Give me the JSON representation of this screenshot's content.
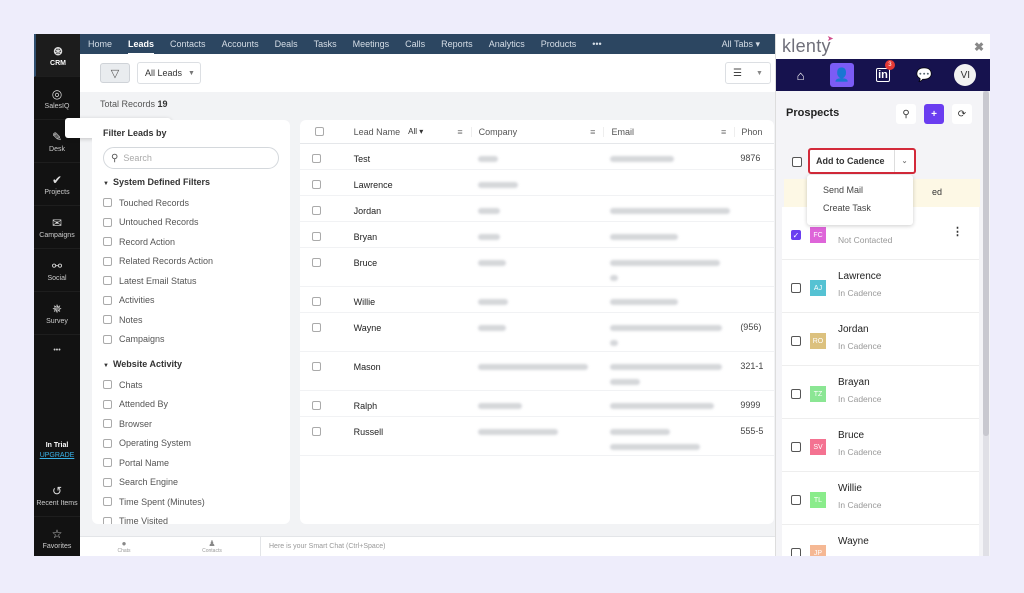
{
  "crm": {
    "leftnav": {
      "items": [
        {
          "label": "CRM",
          "icon": "crm-icon",
          "glyph": "⊛",
          "active": true
        },
        {
          "label": "SalesIQ",
          "icon": "salesiq-icon",
          "glyph": "◎"
        },
        {
          "label": "Desk",
          "icon": "desk-icon",
          "glyph": "✎"
        },
        {
          "label": "Projects",
          "icon": "check-icon",
          "glyph": "✔"
        },
        {
          "label": "Campaigns",
          "icon": "campaigns-icon",
          "glyph": "✉"
        },
        {
          "label": "Social",
          "icon": "social-icon",
          "glyph": "⚯"
        },
        {
          "label": "Survey",
          "icon": "survey-icon",
          "glyph": "✵"
        }
      ],
      "more": "•••",
      "trial_label": "In Trial",
      "upgrade_label": "UPGRADE",
      "recent_label": "Recent Items",
      "recent_glyph": "↺",
      "favorites_label": "Favorites",
      "favorites_glyph": "☆"
    },
    "tabs": [
      "Home",
      "Leads",
      "Contacts",
      "Accounts",
      "Deals",
      "Tasks",
      "Meetings",
      "Calls",
      "Reports",
      "Analytics",
      "Products",
      "•••"
    ],
    "active_tab": "Leads",
    "all_tabs_label": "All Tabs ▾",
    "view_label": "All Leads",
    "total_records_label": "Total Records",
    "total_records_value": "19",
    "filter": {
      "title": "Filter Leads by",
      "search_placeholder": "Search",
      "groups": [
        {
          "title": "System Defined Filters",
          "items": [
            "Touched Records",
            "Untouched Records",
            "Record Action",
            "Related Records Action",
            "Latest Email Status",
            "Activities",
            "Notes",
            "Campaigns"
          ]
        },
        {
          "title": "Website Activity",
          "items": [
            "Chats",
            "Attended By",
            "Browser",
            "Operating System",
            "Portal Name",
            "Search Engine",
            "Time Spent (Minutes)",
            "Time Visited"
          ]
        }
      ]
    },
    "table": {
      "columns": {
        "name": "Lead Name",
        "name_filter": "All ▾",
        "company": "Company",
        "email": "Email",
        "phone": "Phon"
      },
      "rows": [
        {
          "name": "Test",
          "phone": "9876",
          "company_w": 1,
          "email_w": 1,
          "tall": false
        },
        {
          "name": "Lawrence",
          "phone": "",
          "company_w": 1,
          "email_w": 0,
          "tall": false
        },
        {
          "name": "Jordan",
          "phone": "",
          "company_w": 1,
          "email_w": 1,
          "tall": false
        },
        {
          "name": "Bryan",
          "phone": "",
          "company_w": 1,
          "email_w": 1,
          "tall": false
        },
        {
          "name": "Bruce",
          "phone": "",
          "company_w": 1,
          "email_w": 1,
          "tall": true
        },
        {
          "name": "Willie",
          "phone": "",
          "company_w": 1,
          "email_w": 1,
          "tall": false
        },
        {
          "name": "Wayne",
          "phone": "(956)",
          "company_w": 1,
          "email_w": 1,
          "tall": true
        },
        {
          "name": "Mason",
          "phone": "321-1",
          "company_w": 1,
          "email_w": 1,
          "tall": true
        },
        {
          "name": "Ralph",
          "phone": "9999",
          "company_w": 1,
          "email_w": 1,
          "tall": false
        },
        {
          "name": "Russell",
          "phone": "555-5",
          "company_w": 1,
          "email_w": 1,
          "tall": true
        }
      ]
    },
    "bottom": {
      "chats": "Chats",
      "contacts": "Contacts",
      "smart_chat_placeholder": "Here is your Smart Chat (Ctrl+Space)"
    }
  },
  "klenty": {
    "logo": "klenty",
    "linkedin_badge": "3",
    "avatar_initials": "VI",
    "title": "Prospects",
    "add_to_cadence_label": "Add to Cadence",
    "notice_text": "ed",
    "dropdown_items": [
      "Send Mail",
      "Create Task"
    ],
    "prospects": [
      {
        "name": "",
        "initials": "FC",
        "status": "Not Contacted",
        "color": "#d63fd0",
        "checked": true
      },
      {
        "name": "Lawrence",
        "initials": "AJ",
        "status": "In Cadence",
        "color": "#2bb3c9",
        "checked": false
      },
      {
        "name": "Jordan",
        "initials": "RO",
        "status": "In Cadence",
        "color": "#d4b25f",
        "checked": false
      },
      {
        "name": "Brayan",
        "initials": "TZ",
        "status": "In Cadence",
        "color": "#6fe07a",
        "checked": false
      },
      {
        "name": "Bruce",
        "initials": "SV",
        "status": "In Cadence",
        "color": "#f25076",
        "checked": false
      },
      {
        "name": "Willie",
        "initials": "TL",
        "status": "In Cadence",
        "color": "#6de86f",
        "checked": false
      },
      {
        "name": "Wayne",
        "initials": "JP",
        "status": "",
        "color": "#f3a77a",
        "checked": false
      }
    ]
  }
}
